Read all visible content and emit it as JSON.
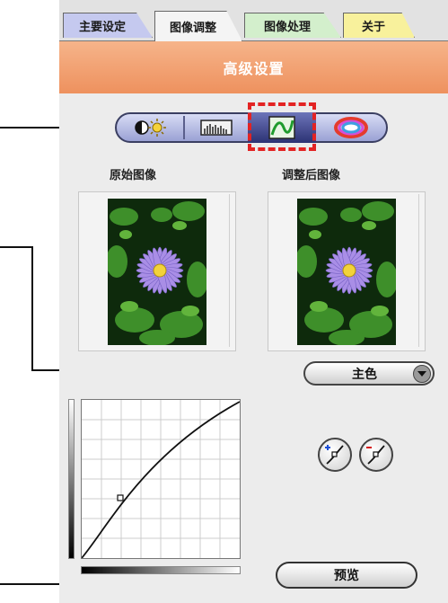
{
  "tabs": [
    {
      "label": "主要设定"
    },
    {
      "label": "图像调整"
    },
    {
      "label": "图像处理"
    },
    {
      "label": "关于"
    }
  ],
  "header": {
    "title": "高级设置"
  },
  "mode_buttons": [
    {
      "icon": "brightness-contrast-icon"
    },
    {
      "icon": "histogram-levels-icon"
    },
    {
      "icon": "tone-curve-icon"
    },
    {
      "icon": "color-balance-icon"
    }
  ],
  "images": {
    "original_label": "原始图像",
    "adjusted_label": "调整后图像"
  },
  "channel": {
    "selected": "主色"
  },
  "curve_buttons": [
    {
      "icon": "add-point-curve-icon"
    },
    {
      "icon": "remove-point-curve-icon"
    }
  ],
  "preview": {
    "label": "预览"
  }
}
